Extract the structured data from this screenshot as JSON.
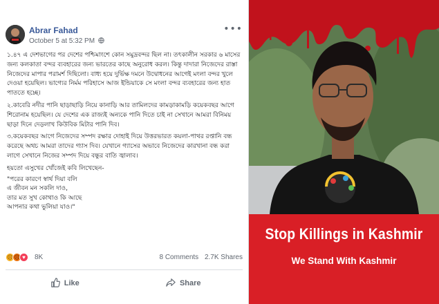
{
  "post": {
    "author": "Abrar Fahad",
    "timestamp": "October 5 at 5:32 PM",
    "privacy_icon": "globe-icon",
    "paragraphs": [
      "১.৪৭ এ দেশভাগের পর দেশের পশ্চিমাংশে কোন সমুদ্রবন্দর ছিল না। তৎকালীন সরকার ৬ মাসের জন্য কলকাতা বন্দর ব্যবহারের জন্য ভারতের কাছে অনুরোধ করল। কিন্তু দাদারা নিজেদের রাস্তা নিজেদের মাপার পরামর্শ দিছিলো। বাধ্য হয়ে দুর্ভিক্ষ দমনে উদ্বোধনের আগেই মংলা বন্দর খুলে দেওয়া হয়েছিল। ভাগ্যের নির্মম পরিহাসে আজ ইন্ডিয়াকে সে মংলা বন্দর ব্যবহারের জন্য হাত পাততে হচ্ছে।",
      "২.কাবেরি নদীর পানি ছাড়াছাড়ি নিয়ে কানাড়ি আর তামিলদের কামড়াকামড়ি কয়েকবছর আগে শিরোনাম হয়েছিল। যে দেশের এক রাজ্যই অন্যকে পানি দিতে চাই না সেখানে আমরা বিনিময় ছাড়া দিনে দেড়লাখ কিউবিক মিটার পানি দিব।",
      "৩.কয়েকবছর আগে নিজেদের সম্পদ রক্ষার দোহাই দিয়ে উত্তরভারত কয়লা-পাথর রপ্তানি বন্ধ করেছে অথচ আমরা তাদের গ্যাস দিব। যেখানে গ্যাসের অভাবে নিজেদের কারখানা বন্ধ করা লাগে সেখানে নিজের সম্পদ দিয়ে বন্ধুর বাতি জ্বালাব।",
      "হয়তো এসুখের খোঁজেই কবি লিখেছেন-"
    ],
    "poem_lines": [
      "\"পরের কারণে স্বার্থ দিয়া বলি",
      "এ জীবন মন সকলি দাও,",
      "তার মত সুখ কোথাও কি আছে",
      "আপনার কথা ভুলিয়া যাও।\""
    ],
    "reaction_count": "8K",
    "comments": "8 Comments",
    "shares": "2.7K Shares",
    "like_label": "Like",
    "share_label": "Share",
    "link_color": "#385898"
  },
  "poster": {
    "title": "Stop Killings in Kashmir",
    "subtitle": "We Stand With Kashmir",
    "banner_color": "#d91f26"
  }
}
